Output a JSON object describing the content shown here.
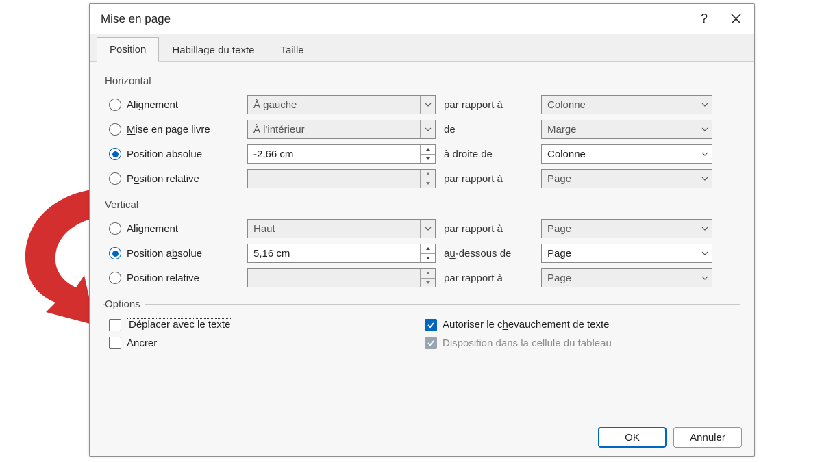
{
  "dialog": {
    "title": "Mise en page",
    "help_glyph": "?",
    "tabs": [
      {
        "label": "Position",
        "active": true
      },
      {
        "label": "Habillage du texte",
        "active": false
      },
      {
        "label": "Taille",
        "active": false
      }
    ]
  },
  "groups": {
    "horizontal": {
      "legend": "Horizontal",
      "rows": [
        {
          "kind": "radio",
          "selected": false,
          "label_pre": "",
          "label_u": "A",
          "label_post": "lignement",
          "value": "À gauche",
          "value_disabled": true,
          "mid": "par rapport à",
          "ref": "Colonne",
          "ref_disabled": true,
          "mode": "combo"
        },
        {
          "kind": "radio",
          "selected": false,
          "label_pre": "",
          "label_u": "M",
          "label_post": "ise en page livre",
          "value": "À l'intérieur",
          "value_disabled": true,
          "mid": "de",
          "ref": "Marge",
          "ref_disabled": true,
          "mode": "combo"
        },
        {
          "kind": "radio",
          "selected": true,
          "label_pre": "",
          "label_u": "P",
          "label_post": "osition absolue",
          "value": "-2,66 cm",
          "value_disabled": false,
          "mid_pre": "à droi",
          "mid_u": "t",
          "mid_post": "e de",
          "ref": "Colonne",
          "ref_disabled": false,
          "mode": "spin"
        },
        {
          "kind": "radio",
          "selected": false,
          "label_pre": "P",
          "label_u": "o",
          "label_post": "sition relative",
          "value": "",
          "value_disabled": true,
          "mid": "par rapport à",
          "ref": "Page",
          "ref_disabled": true,
          "mode": "spin"
        }
      ]
    },
    "vertical": {
      "legend": "Vertical",
      "rows": [
        {
          "kind": "radio",
          "selected": false,
          "label_pre": "Alignement",
          "label_u": "",
          "label_post": "",
          "value": "Haut",
          "value_disabled": true,
          "mid": "par rapport à",
          "ref": "Page",
          "ref_disabled": true,
          "mode": "combo"
        },
        {
          "kind": "radio",
          "selected": true,
          "label_pre": "Position a",
          "label_u": "b",
          "label_post": "solue",
          "value": "5,16 cm",
          "value_disabled": false,
          "mid_pre": "a",
          "mid_u": "u",
          "mid_post": "-dessous de",
          "ref": "Page",
          "ref_disabled": false,
          "mode": "spin"
        },
        {
          "kind": "radio",
          "selected": false,
          "label_pre": "Position relative",
          "label_u": "",
          "label_post": "",
          "value": "",
          "value_disabled": true,
          "mid": "par rapport à",
          "ref": "Page",
          "ref_disabled": true,
          "mode": "spin"
        }
      ]
    },
    "options": {
      "legend": "Options",
      "checks": [
        {
          "id": "move-with-text",
          "checked": false,
          "disabled": false,
          "focused": true,
          "label": "Déplacer avec le texte"
        },
        {
          "id": "allow-overlap",
          "checked": true,
          "disabled": false,
          "focused": false,
          "label_pre": "Autoriser le c",
          "label_u": "h",
          "label_post": "evauchement de texte"
        },
        {
          "id": "anchor",
          "checked": false,
          "disabled": false,
          "focused": false,
          "label_pre": "A",
          "label_u": "n",
          "label_post": "crer"
        },
        {
          "id": "cell-layout",
          "checked": true,
          "disabled": true,
          "focused": false,
          "label": "Disposition dans la cellule du tableau"
        }
      ]
    }
  },
  "buttons": {
    "ok": "OK",
    "cancel": "Annuler"
  },
  "annotation": {
    "color": "#d32f2f"
  }
}
